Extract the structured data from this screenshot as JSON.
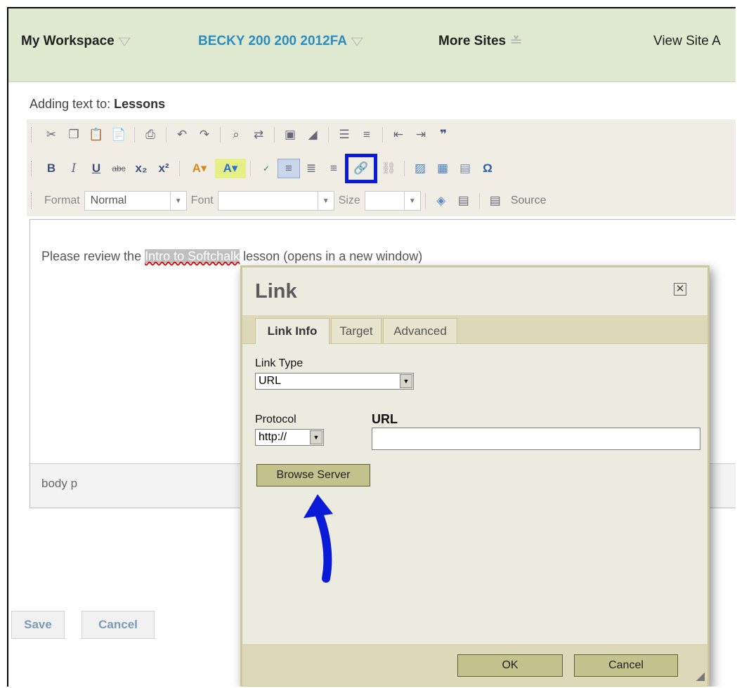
{
  "nav": {
    "my_workspace": "My Workspace",
    "site": "BECKY 200 200 2012FA",
    "more_sites": "More Sites",
    "view_site": "View Site A"
  },
  "adding": {
    "prefix": "Adding text to:",
    "tool": "Lessons"
  },
  "toolbar": {
    "format_label": "Format",
    "format_value": "Normal",
    "font_label": "Font",
    "font_value": "",
    "size_label": "Size",
    "size_value": "",
    "source_label": "Source",
    "icons_row1": [
      "cut-icon",
      "copy-icon",
      "paste-icon",
      "paste-word-icon",
      "print-icon",
      "undo-icon",
      "redo-icon",
      "find-icon",
      "replace-icon",
      "select-all-icon",
      "remove-format-icon",
      "numbered-list-icon",
      "bulleted-list-icon",
      "outdent-icon",
      "indent-icon",
      "blockquote-icon"
    ],
    "icons_row2": [
      "bold-icon",
      "italic-icon",
      "underline-icon",
      "strike-icon",
      "subscript-icon",
      "superscript-icon",
      "text-color-icon",
      "bg-color-icon",
      "spellcheck-icon",
      "align-left-icon",
      "align-center-icon",
      "align-right-icon",
      "link-icon",
      "unlink-icon",
      "image-icon",
      "table-icon",
      "horizontal-rule-icon",
      "special-char-icon"
    ]
  },
  "editor": {
    "before": "Please review the ",
    "selected": "Intro to Softchalk",
    "after": " lesson (opens in a new window)",
    "path": "body  p"
  },
  "buttons": {
    "save": "Save",
    "cancel": "Cancel"
  },
  "dialog": {
    "title": "Link",
    "tabs": [
      "Link Info",
      "Target",
      "Advanced"
    ],
    "link_type_label": "Link Type",
    "link_type_value": "URL",
    "protocol_label": "Protocol",
    "protocol_value": "http://",
    "url_label": "URL",
    "url_value": "",
    "browse": "Browse Server",
    "ok": "OK",
    "cancel": "Cancel"
  },
  "colors": {
    "nav_bg": "#dfe9cf",
    "site_link": "#2a8cc0",
    "highlight": "#0a1bd8",
    "dialog_bg": "#ecebdf"
  }
}
